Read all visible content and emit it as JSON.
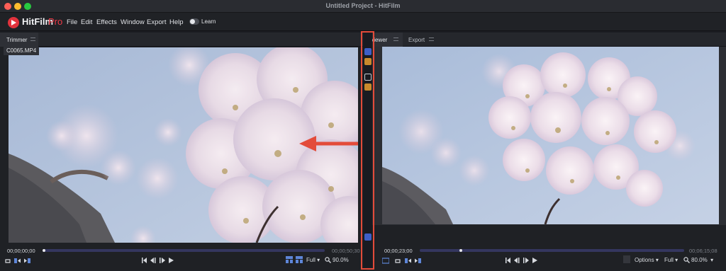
{
  "window": {
    "title": "Untitled Project - HitFilm"
  },
  "app": {
    "name": "HitFilm",
    "edition": "Pro"
  },
  "menu": [
    "File",
    "Edit",
    "Effects",
    "Window",
    "Export",
    "Help"
  ],
  "learn_label": "Learn",
  "trimmer": {
    "tab_label": "Trimmer",
    "clip_name": "C0065.MP4",
    "start_timecode": "00;00;00;00",
    "end_timecode": "00;00;50;30",
    "quality": "Full",
    "zoom": "90.0%",
    "playhead_fraction": 0.0
  },
  "viewer": {
    "tab_label": "Viewer",
    "export_tab_label": "Export",
    "current_timecode": "00;00;23;00",
    "end_timecode": "00;06;15;08",
    "options_label": "Options",
    "quality": "Full",
    "zoom": "80.0%",
    "playhead_fraction": 0.15
  },
  "annotation": {
    "color": "#e34b3a"
  },
  "colors": {
    "accent": "#e2323c",
    "scrub_track": "#34365f",
    "sky": "#a9bcd9"
  }
}
